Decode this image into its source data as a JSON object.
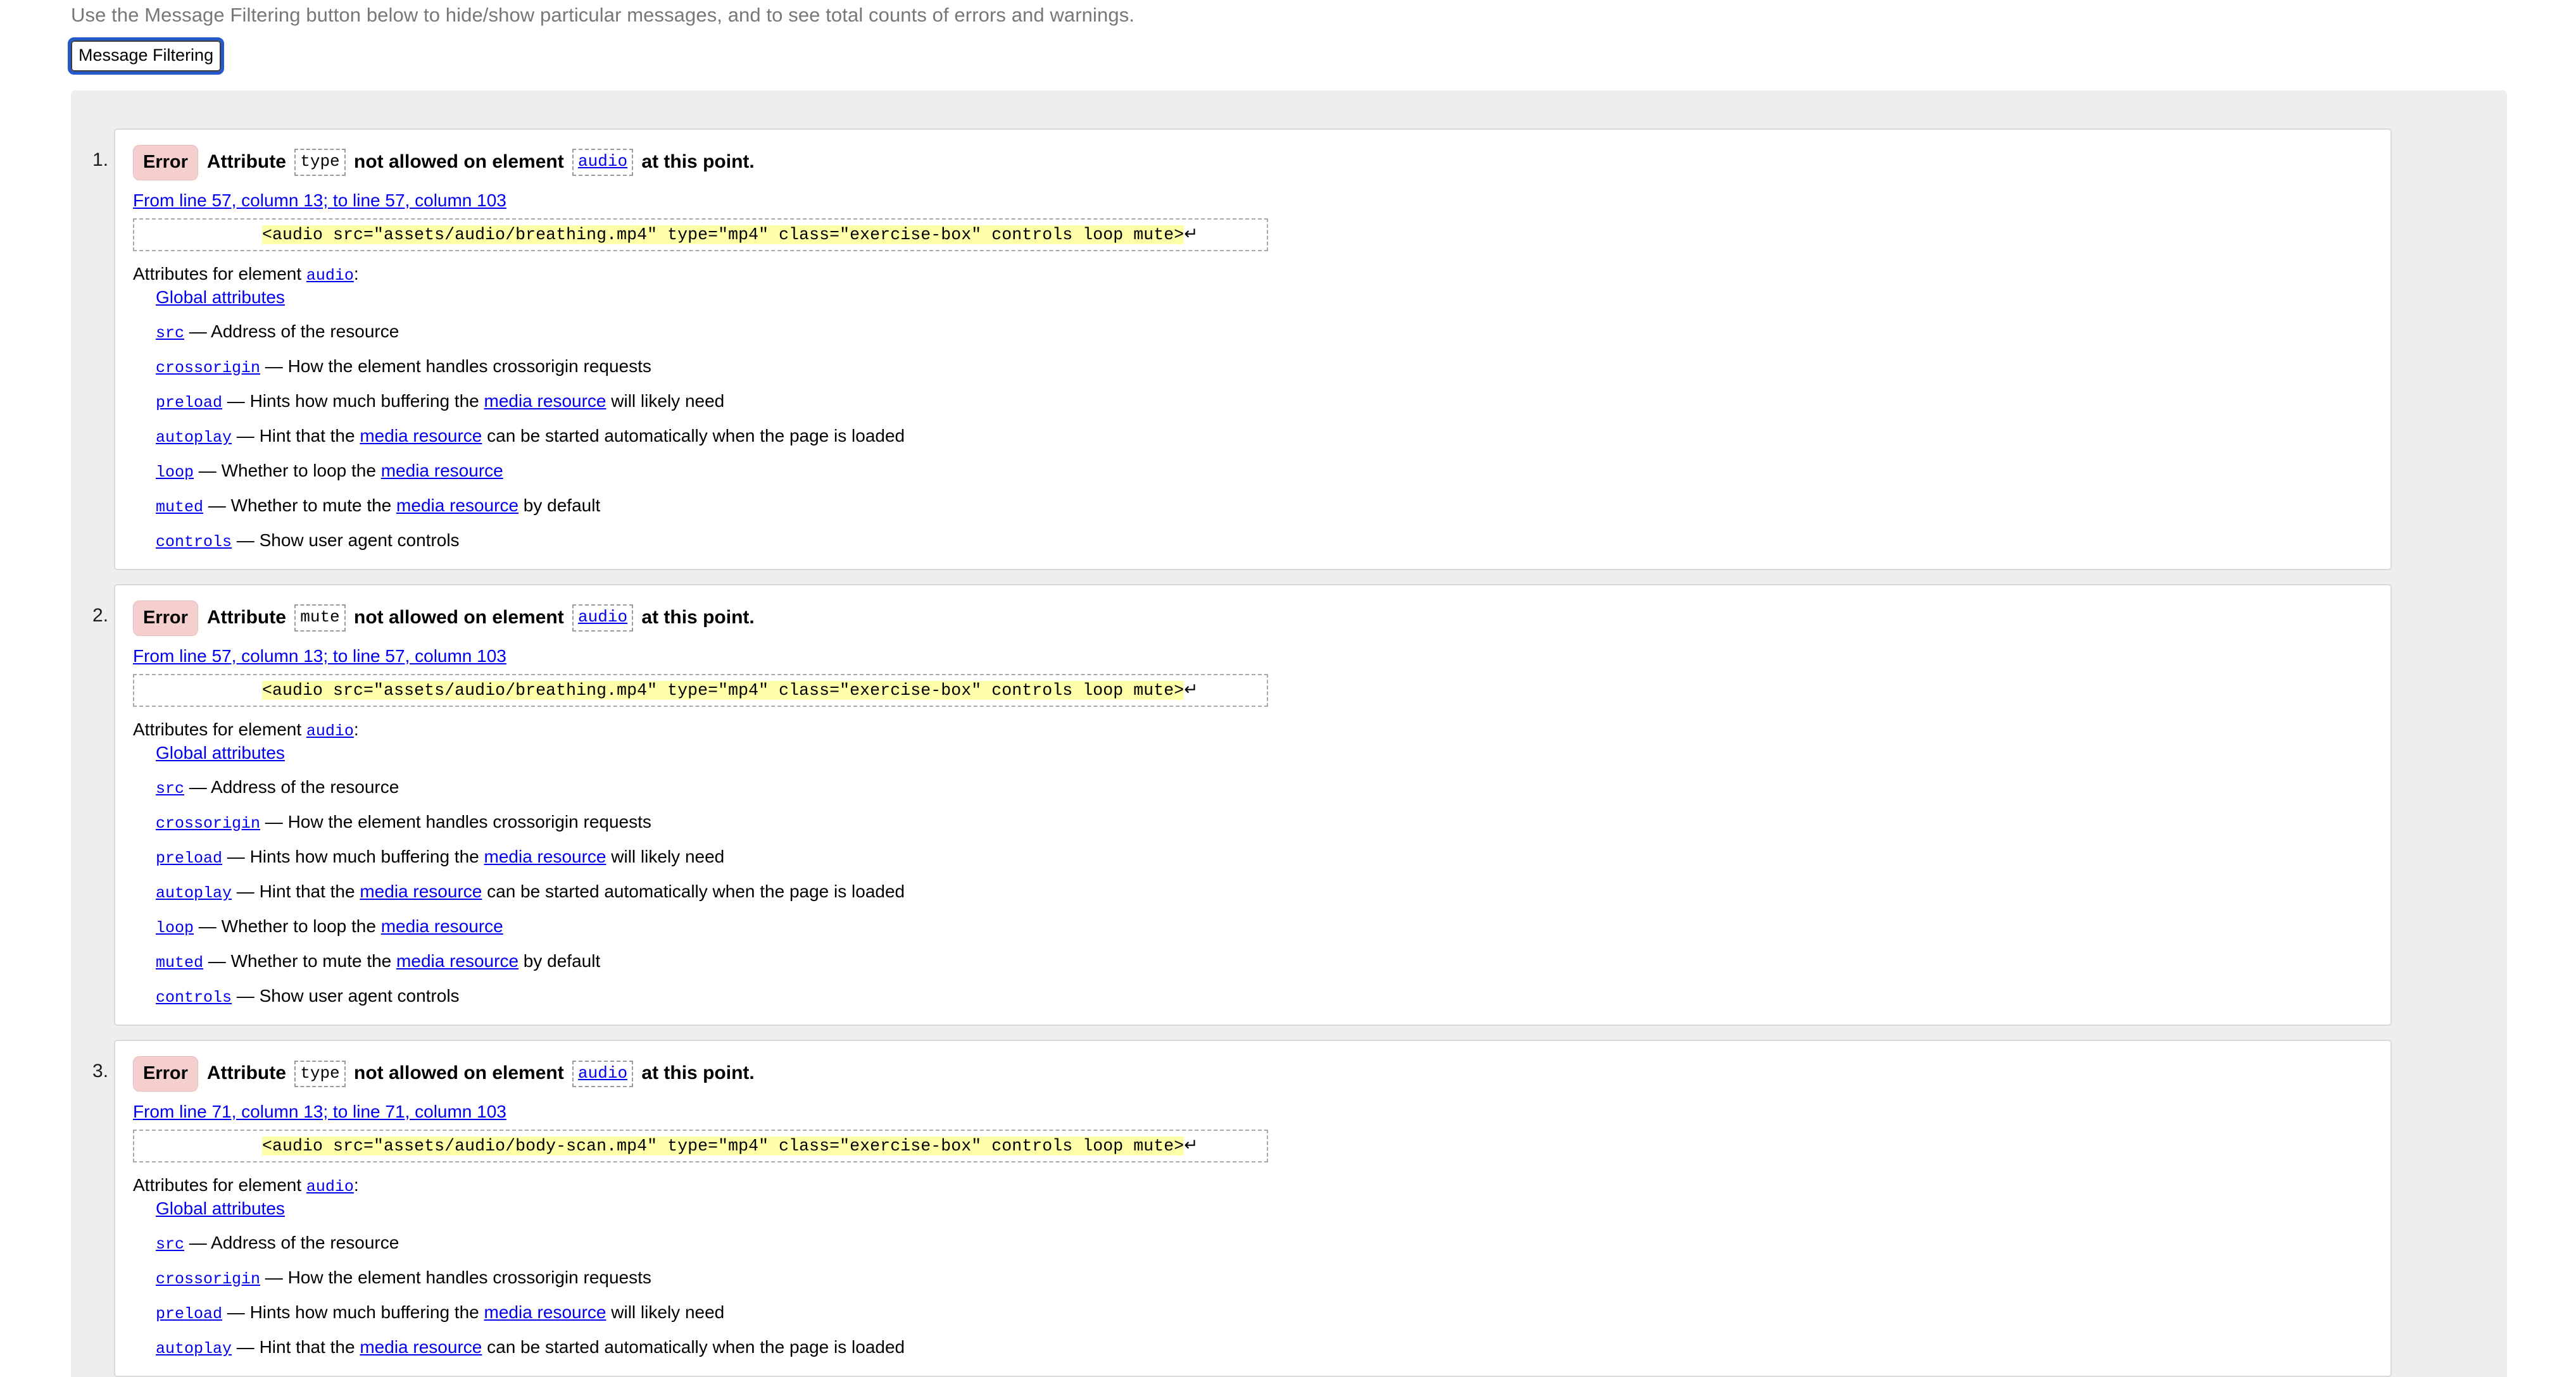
{
  "intro": {
    "text": "Use the Message Filtering button below to hide/show particular messages, and to see total counts of errors and warnings."
  },
  "toolbar": {
    "message_filtering_label": "Message Filtering"
  },
  "labels": {
    "badge_error": "Error",
    "attributes_intro_prefix": "Attributes for element ",
    "attributes_intro_suffix": ":",
    "global_attributes": "Global attributes",
    "em_dash": " — ",
    "media_resource": "media resource",
    "carriage_return": "↵"
  },
  "colors": {
    "error_badge_bg": "#f4cfce",
    "highlight": "#ffffaa",
    "link": "#0000ee",
    "container_bg": "#eeeeee",
    "card_border": "#dadada",
    "focus_ring": "#2558c8",
    "intro_text": "#777777"
  },
  "attribute_rows": [
    {
      "name": "src",
      "pre": " — Address of the resource",
      "link": "",
      "post": ""
    },
    {
      "name": "crossorigin",
      "pre": " — How the element handles crossorigin requests",
      "link": "",
      "post": ""
    },
    {
      "name": "preload",
      "pre": " — Hints how much buffering the ",
      "link": "media resource",
      "post": " will likely need"
    },
    {
      "name": "autoplay",
      "pre": " — Hint that the ",
      "link": "media resource",
      "post": " can be started automatically when the page is loaded"
    },
    {
      "name": "loop",
      "pre": " — Whether to loop the ",
      "link": "media resource",
      "post": ""
    },
    {
      "name": "muted",
      "pre": " — Whether to mute the ",
      "link": "media resource",
      "post": " by default"
    },
    {
      "name": "controls",
      "pre": " — Show user agent controls",
      "link": "",
      "post": ""
    }
  ],
  "messages": [
    {
      "index": "1.",
      "type": "Error",
      "head_before": "Attribute ",
      "head_code": "type",
      "head_middle": "not allowed on element ",
      "head_element": "audio",
      "head_after": "at this point.",
      "location": "From line 57, column 13; to line 57, column 103",
      "extract_indent": "            ",
      "extract_code": "<audio src=\"assets/audio/breathing.mp4\" type=\"mp4\" class=\"exercise-box\" controls loop mute>",
      "element": "audio",
      "attrs_shown": 7
    },
    {
      "index": "2.",
      "type": "Error",
      "head_before": "Attribute ",
      "head_code": "mute",
      "head_middle": "not allowed on element ",
      "head_element": "audio",
      "head_after": "at this point.",
      "location": "From line 57, column 13; to line 57, column 103",
      "extract_indent": "            ",
      "extract_code": "<audio src=\"assets/audio/breathing.mp4\" type=\"mp4\" class=\"exercise-box\" controls loop mute>",
      "element": "audio",
      "attrs_shown": 7
    },
    {
      "index": "3.",
      "type": "Error",
      "head_before": "Attribute ",
      "head_code": "type",
      "head_middle": "not allowed on element ",
      "head_element": "audio",
      "head_after": "at this point.",
      "location": "From line 71, column 13; to line 71, column 103",
      "extract_indent": "            ",
      "extract_code": "<audio src=\"assets/audio/body-scan.mp4\" type=\"mp4\" class=\"exercise-box\" controls loop mute>",
      "element": "audio",
      "attrs_shown": 4
    }
  ]
}
